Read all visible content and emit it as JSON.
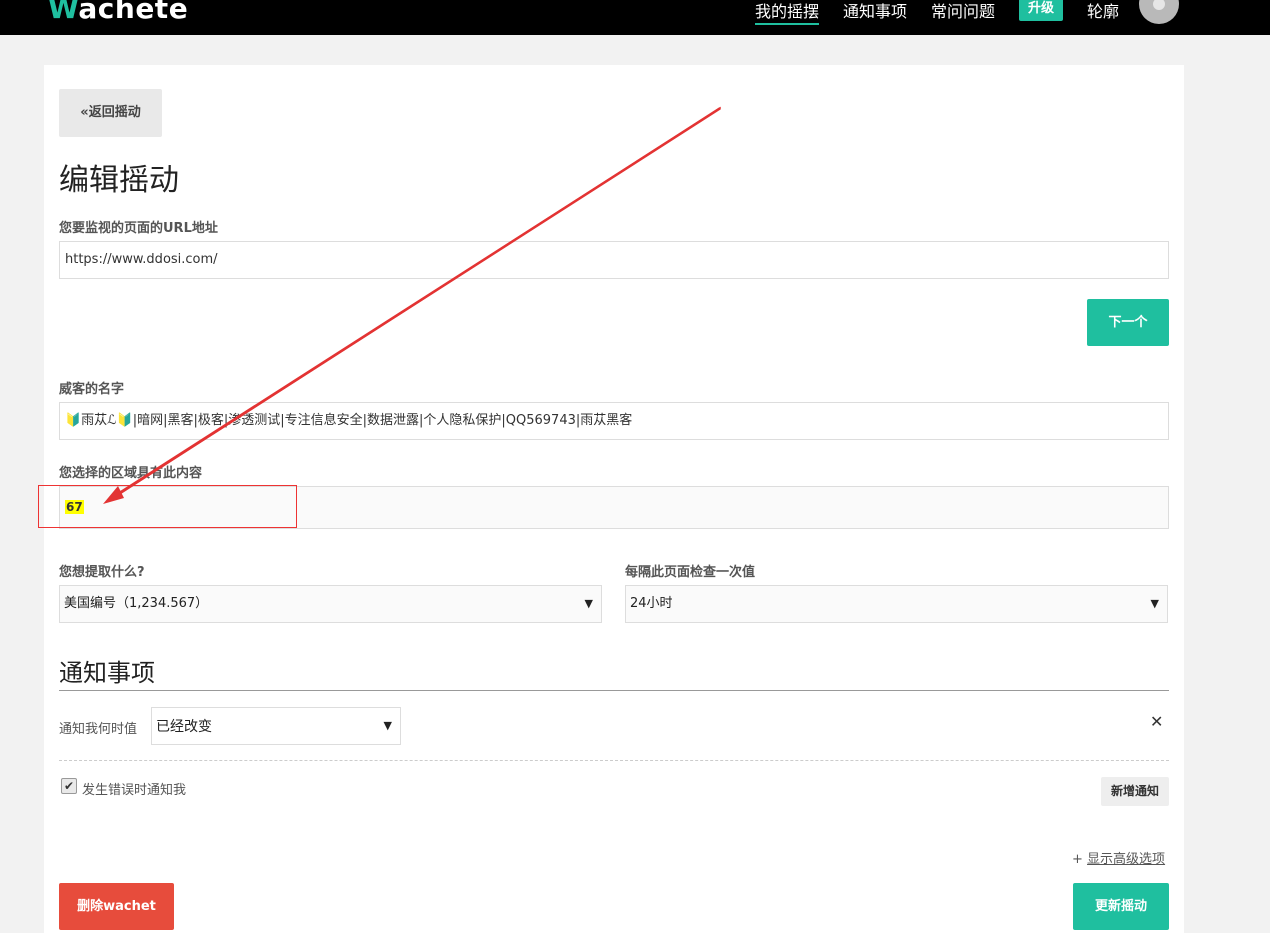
{
  "header": {
    "logo_w": "W",
    "logo_rest": "achete",
    "nav": [
      "我的摇摆",
      "通知事项",
      "常问问题"
    ],
    "upgrade": "升级",
    "user": "轮廓"
  },
  "form": {
    "back": "«返回摇动",
    "title": "编辑摇动",
    "url_label": "您要监视的页面的URL地址",
    "url_value": "https://www.ddosi.com/",
    "next_button": "下一个",
    "name_label": "威客的名字",
    "name_value": "🔰雨苁ℒ🔰|暗网|黑客|极客|渗透测试|专注信息安全|数据泄露|个人隐私保护|QQ569743|雨苁黑客",
    "content_label": "您选择的区域具有此内容",
    "content_value": "67",
    "extract_label": "您想提取什么?",
    "extract_value": "美国编号（1,234.567）",
    "interval_label": "每隔此页面检查一次值",
    "interval_value": "24小时"
  },
  "notifications": {
    "title": "通知事项",
    "when_label": "通知我何时值",
    "when_value": "已经改变",
    "close_symbol": "✕",
    "error_checkbox_label": "发生错误时通知我",
    "add_button": "新增通知",
    "advanced_prefix": "+",
    "advanced_link": "显示高级选项"
  },
  "actions": {
    "delete": "删除wachet",
    "update": "更新摇动"
  },
  "colors": {
    "accent": "#1fbf9f",
    "danger": "#e74c3c",
    "annotation": "#e33333",
    "highlight": "#ffff00"
  }
}
